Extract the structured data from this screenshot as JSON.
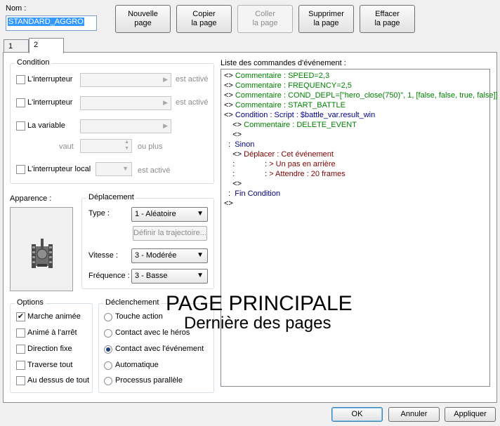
{
  "name_label": "Nom :",
  "name_value": "STANDARD_AGGRO",
  "toolbar": {
    "new_page": "Nouvelle\npage",
    "copy_page": "Copier\nla page",
    "paste_page": "Coller\nla page",
    "delete_page": "Supprimer\nla page",
    "clear_page": "Effacer\nla page"
  },
  "tabs": [
    "1",
    "2"
  ],
  "condition": {
    "title": "Condition",
    "switch1_label": "L'interrupteur",
    "switch1_suffix": "est activé",
    "switch2_label": "L'interrupteur",
    "switch2_suffix": "est activé",
    "variable_label": "La variable",
    "vaut_label": "vaut",
    "ou_plus": "ou plus",
    "local_label": "L'interrupteur local",
    "local_suffix": "est activé"
  },
  "apparence_label": "Apparence :",
  "deplacement": {
    "title": "Déplacement",
    "type_label": "Type :",
    "type_value": "1 - Aléatoire",
    "route_button": "Définir la trajectoire...",
    "speed_label": "Vitesse :",
    "speed_value": "3 - Modérée",
    "freq_label": "Fréquence :",
    "freq_value": "3 - Basse"
  },
  "options": {
    "title": "Options",
    "items": [
      {
        "label": "Marche animée",
        "checked": true
      },
      {
        "label": "Animé à l'arrêt",
        "checked": false
      },
      {
        "label": "Direction fixe",
        "checked": false
      },
      {
        "label": "Traverse tout",
        "checked": false
      },
      {
        "label": "Au dessus de tout",
        "checked": false
      }
    ]
  },
  "trigger": {
    "title": "Déclenchement",
    "items": [
      {
        "label": "Touche action",
        "selected": false
      },
      {
        "label": "Contact avec le héros",
        "selected": false
      },
      {
        "label": "Contact avec l'événement",
        "selected": true
      },
      {
        "label": "Automatique",
        "selected": false
      },
      {
        "label": "Processus parallèle",
        "selected": false
      }
    ]
  },
  "commands_label": "Liste des commandes d'événement :",
  "commands": [
    {
      "prefix": "<> ",
      "text": "Commentaire : SPEED=2,3",
      "color": "green"
    },
    {
      "prefix": "<> ",
      "text": "Commentaire : FREQUENCY=2,5",
      "color": "green"
    },
    {
      "prefix": "<> ",
      "text": "Commentaire : COND_DEPL=[\"hero_close(750)\", 1, [false, false, true, false]]",
      "color": "green"
    },
    {
      "prefix": "<> ",
      "text": "Commentaire : START_BATTLE",
      "color": "green"
    },
    {
      "prefix": "<> ",
      "text": "Condition : Script : $battle_var.result_win",
      "color": "blue"
    },
    {
      "prefix": "    <> ",
      "text": "Commentaire : DELETE_EVENT",
      "color": "green"
    },
    {
      "prefix": "    <>",
      "text": "",
      "color": "black"
    },
    {
      "prefix": "  :  ",
      "text": "Sinon",
      "color": "blue"
    },
    {
      "prefix": "    <> ",
      "text": "Déplacer : Cet événement",
      "color": "red"
    },
    {
      "prefix": "    :              : ",
      "text": "> Un pas en arrière",
      "color": "red"
    },
    {
      "prefix": "    :              : ",
      "text": "> Attendre : 20 frames",
      "color": "red"
    },
    {
      "prefix": "    <>",
      "text": "",
      "color": "black"
    },
    {
      "prefix": "  :  ",
      "text": "Fin Condition",
      "color": "blue"
    },
    {
      "prefix": "<>",
      "text": "",
      "color": "black"
    }
  ],
  "overlay": {
    "title": "PAGE PRINCIPALE",
    "subtitle": "Dernière des pages"
  },
  "buttons": {
    "ok": "OK",
    "cancel": "Annuler",
    "apply": "Appliquer"
  },
  "colors": {
    "comment": "#008000",
    "condition": "#000080",
    "move": "#800000"
  }
}
